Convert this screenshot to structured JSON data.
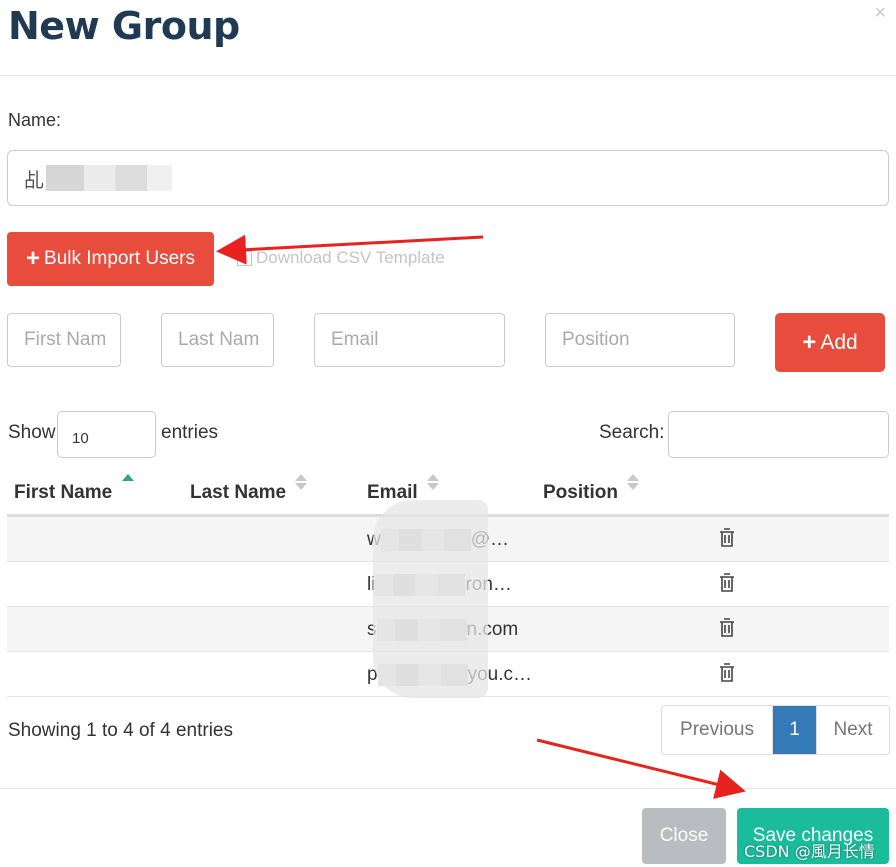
{
  "modal": {
    "title": "New Group",
    "close_glyph": "×"
  },
  "form": {
    "name_label": "Name:",
    "name_value_prefix": "乩",
    "bulk_import_label": "Bulk Import Users",
    "download_csv_label": "Download CSV Template",
    "first_name_placeholder": "First Nam",
    "last_name_placeholder": "Last Nam",
    "email_placeholder": "Email",
    "position_placeholder": "Position",
    "add_label": "Add"
  },
  "table_controls": {
    "show_label": "Show",
    "page_length": "10",
    "entries_label": "entries",
    "search_label": "Search:"
  },
  "table": {
    "columns": [
      "First Name",
      "Last Name",
      "Email",
      "Position"
    ],
    "rows": [
      {
        "first": "",
        "last": "",
        "email_start": "w",
        "email_end": "@…",
        "position": ""
      },
      {
        "first": "",
        "last": "",
        "email_start": "li",
        "email_end": "ron…",
        "position": ""
      },
      {
        "first": "",
        "last": "",
        "email_start": "s",
        "email_end": "n.com",
        "position": ""
      },
      {
        "first": "",
        "last": "",
        "email_start": "p",
        "email_end": "you.c…",
        "position": ""
      }
    ]
  },
  "pagination": {
    "info": "Showing 1 to 4 of 4 entries",
    "previous": "Previous",
    "current_page": "1",
    "next": "Next"
  },
  "footer": {
    "close_label": "Close",
    "save_label": "Save changes"
  },
  "watermark": "CSDN @風月长情",
  "colors": {
    "danger": "#e74c3c",
    "success": "#1abc9c",
    "primary": "#337ab7",
    "title": "#1f3a52",
    "annotation_arrow": "#e8231f"
  }
}
